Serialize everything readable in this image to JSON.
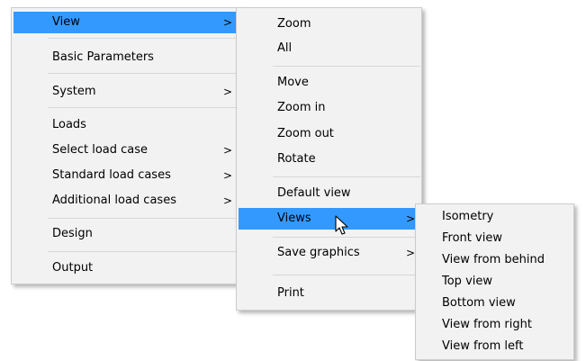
{
  "main_menu": {
    "items": [
      {
        "label": "View",
        "arrow": ">"
      },
      {
        "label": "Basic Parameters"
      },
      {
        "label": "System",
        "arrow": ">"
      },
      {
        "label": "Loads"
      },
      {
        "label": "Select load case",
        "arrow": ">"
      },
      {
        "label": "Standard load cases",
        "arrow": ">"
      },
      {
        "label": "Additional load cases",
        "arrow": ">"
      },
      {
        "label": "Design"
      },
      {
        "label": "Output"
      }
    ]
  },
  "view_menu": {
    "items": [
      {
        "label": "Zoom"
      },
      {
        "label": "All"
      },
      {
        "label": "Move"
      },
      {
        "label": "Zoom in"
      },
      {
        "label": "Zoom out"
      },
      {
        "label": "Rotate"
      },
      {
        "label": "Default view"
      },
      {
        "label": "Views",
        "arrow": ">"
      },
      {
        "label": "Save graphics",
        "arrow": ">"
      },
      {
        "label": "Print"
      }
    ]
  },
  "views_menu": {
    "items": [
      {
        "label": "Isometry"
      },
      {
        "label": "Front view"
      },
      {
        "label": "View from behind"
      },
      {
        "label": "Top view"
      },
      {
        "label": "Bottom view"
      },
      {
        "label": "View from right"
      },
      {
        "label": "View from left"
      }
    ]
  },
  "colors": {
    "highlight": "#3399ff",
    "menu_background": "#f2f2f2",
    "separator": "#d7d7d7"
  },
  "cursor": {
    "icon": "arrow-cursor-icon"
  }
}
